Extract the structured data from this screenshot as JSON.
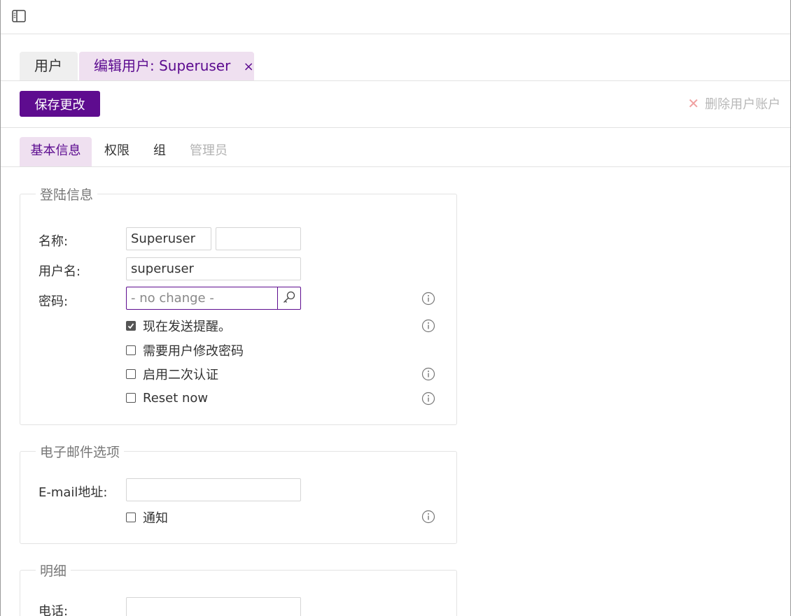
{
  "doc_tabs": {
    "users_label": "用户",
    "edit_label": "编辑用户: Superuser",
    "close_glyph": "×"
  },
  "toolbar": {
    "save_label": "保存更改",
    "delete_glyph": "✕",
    "delete_label": "删除用户账户"
  },
  "sub_tabs": [
    "基本信息",
    "权限",
    "组",
    "管理员"
  ],
  "login": {
    "legend": "登陆信息",
    "name_label": "名称:",
    "first_name": "Superuser",
    "last_name": "",
    "username_label": "用户名:",
    "username": "superuser",
    "password_label": "密码:",
    "password_placeholder": "- no change -",
    "send_reminder": "现在发送提醒。",
    "require_change": "需要用户修改密码",
    "enable_2fa": "启用二次认证",
    "reset_now": "Reset now"
  },
  "email": {
    "legend": "电子邮件选项",
    "email_label": "E-mail地址:",
    "email_value": "",
    "notify_label": "通知"
  },
  "details": {
    "legend": "明细",
    "phone_label": "电话:",
    "phone_value": ""
  },
  "colors": {
    "accent": "#5e0c8f",
    "tab_active_bg": "#efe0f0",
    "muted": "#b3b3b3"
  },
  "checkboxes": {
    "send_reminder": true,
    "require_change": false,
    "enable_2fa": false,
    "reset_now": false,
    "notify": false
  }
}
